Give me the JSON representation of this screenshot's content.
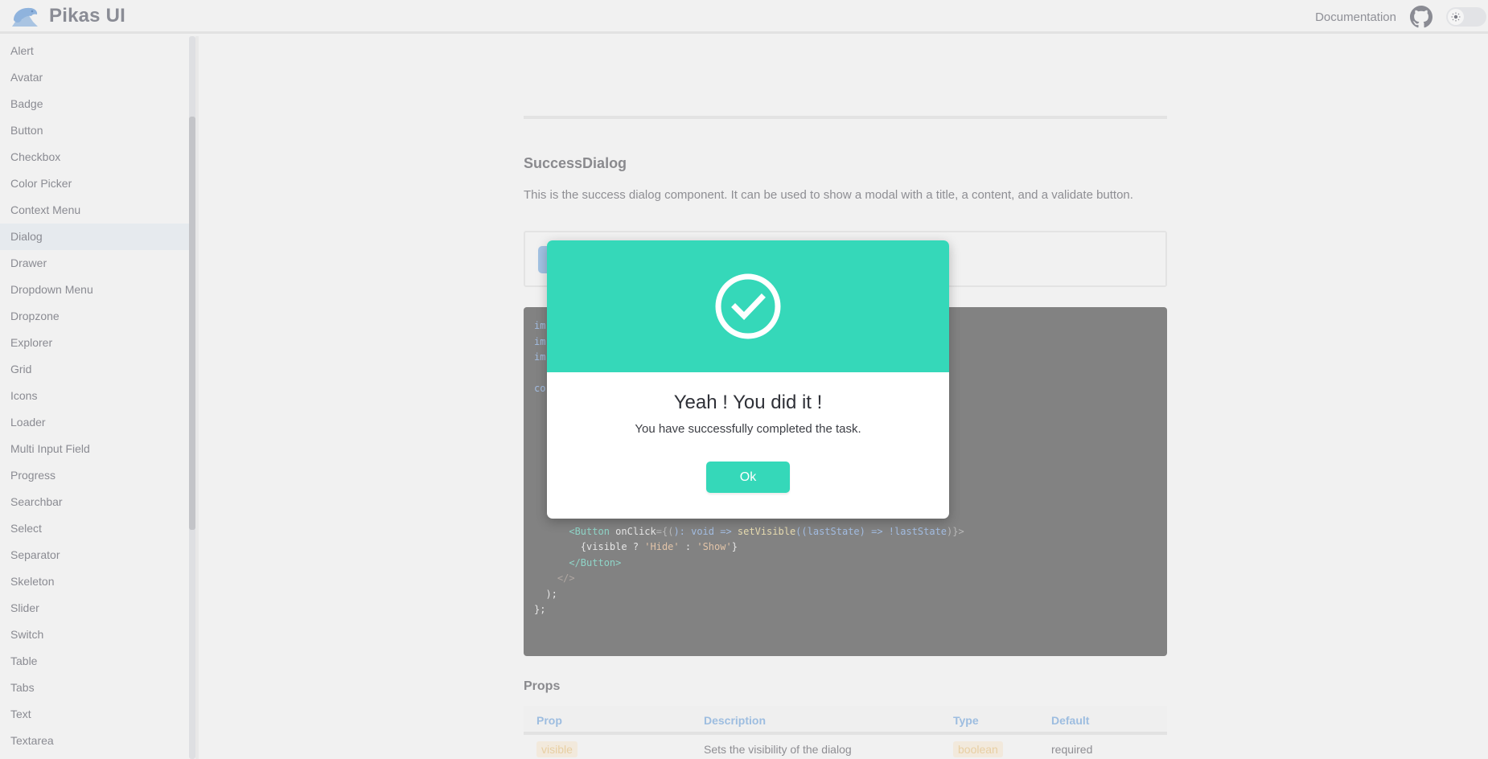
{
  "header": {
    "brand": "Pikas UI",
    "logo_icon": "pika-logo-icon",
    "documentation_link": "Documentation",
    "github_icon": "github-icon",
    "theme_toggle_icon": "sun-icon"
  },
  "sidebar": {
    "active": "Dialog",
    "items": [
      {
        "label": "Alert"
      },
      {
        "label": "Avatar"
      },
      {
        "label": "Badge"
      },
      {
        "label": "Button"
      },
      {
        "label": "Checkbox"
      },
      {
        "label": "Color Picker"
      },
      {
        "label": "Context Menu"
      },
      {
        "label": "Dialog"
      },
      {
        "label": "Drawer"
      },
      {
        "label": "Dropdown Menu"
      },
      {
        "label": "Dropzone"
      },
      {
        "label": "Explorer"
      },
      {
        "label": "Grid"
      },
      {
        "label": "Icons"
      },
      {
        "label": "Loader"
      },
      {
        "label": "Multi Input Field"
      },
      {
        "label": "Progress"
      },
      {
        "label": "Searchbar"
      },
      {
        "label": "Select"
      },
      {
        "label": "Separator"
      },
      {
        "label": "Skeleton"
      },
      {
        "label": "Slider"
      },
      {
        "label": "Switch"
      },
      {
        "label": "Table"
      },
      {
        "label": "Tabs"
      },
      {
        "label": "Text"
      },
      {
        "label": "Textarea"
      }
    ]
  },
  "main": {
    "section_title": "SuccessDialog",
    "section_description": "This is the success dialog component. It can be used to show a modal with a title, a content, and a validate button.",
    "code": {
      "visible_fragments": {
        "line1": "im",
        "line2": "im",
        "line3": "im",
        "line5": "co",
        "self_close": "/>",
        "button_open_tag": "<Button",
        "onclick_attr": "onClick",
        "onclick_eq": "={(",
        "onclick_sig": "): void =>",
        "setvisible_fn": "setVisible",
        "arrow_param": "((lastState) =>",
        "not_last": "!lastState",
        "close_brace": ")}>",
        "ternary_open": "{visible ?",
        "hide_str": "'Hide'",
        "colon": ":",
        "show_str": "'Show'",
        "ternary_close": "}",
        "button_close_tag": "</Button>",
        "fragment_close": "</>",
        "return_close": ");",
        "fn_close": "};"
      }
    },
    "props_title": "Props",
    "props_table": {
      "columns": [
        "Prop",
        "Description",
        "Type",
        "Default"
      ],
      "rows": [
        {
          "prop": "visible",
          "description": "Sets the visibility of the dialog",
          "type": "boolean",
          "default": "required"
        }
      ]
    }
  },
  "dialog": {
    "icon": "check-circle-icon",
    "title": "Yeah ! You did it !",
    "message": "You have successfully completed the task.",
    "ok_label": "Ok",
    "accent_color": "#35d8b9"
  },
  "colors": {
    "accent": "#35d8b9",
    "background": "#f1f1f1",
    "brand_text": "#8a8c95",
    "table_header": "#9dbde0"
  }
}
